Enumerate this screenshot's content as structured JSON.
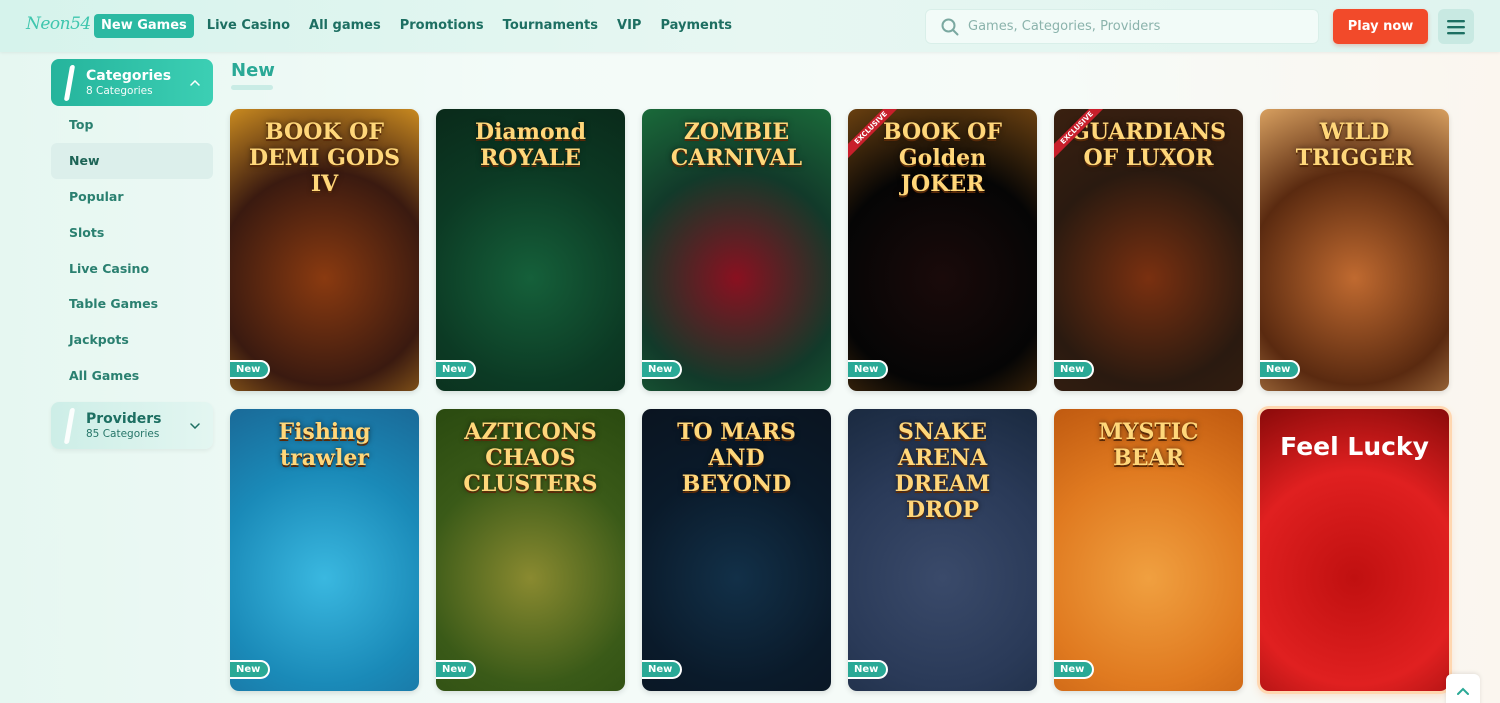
{
  "header": {
    "logo": "Neon54",
    "nav": [
      "New Games",
      "Live Casino",
      "All games",
      "Promotions",
      "Tournaments",
      "VIP",
      "Payments"
    ],
    "search_placeholder": "Games, Categories, Providers",
    "play_label": "Play now"
  },
  "sidebar": {
    "categories_title": "Categories",
    "categories_sub": "8 Categories",
    "items": [
      "Top",
      "New",
      "Popular",
      "Slots",
      "Live Casino",
      "Table Games",
      "Jackpots",
      "All Games"
    ],
    "providers_title": "Providers",
    "providers_sub": "85 Categories"
  },
  "main": {
    "section_title": "New",
    "badge": "New",
    "exclusive": "EXCLUSIVE",
    "games": [
      {
        "title": "BOOK OF DEMI GODS IV",
        "colors": [
          "#3a1a10",
          "#8a3a10",
          "#c98a20"
        ]
      },
      {
        "title": "Diamond ROYALE",
        "colors": [
          "#0c3a24",
          "#15603a",
          "#0a2a1a"
        ]
      },
      {
        "title": "ZOMBIE CARNIVAL",
        "colors": [
          "#123a2a",
          "#8a1020",
          "#1a6a3a"
        ]
      },
      {
        "title": "BOOK OF Golden JOKER",
        "colors": [
          "#050505",
          "#1a0a0a",
          "#6a4010"
        ]
      },
      {
        "title": "GUARDIANS OF LUXOR",
        "colors": [
          "#2a1a10",
          "#7a3010",
          "#3a2010"
        ]
      },
      {
        "title": "WILD TRIGGER",
        "colors": [
          "#5a2a10",
          "#c06a30",
          "#d8a060"
        ]
      },
      {
        "title": "Fishing trawler",
        "colors": [
          "#1a8ab8",
          "#3ab8e0",
          "#1a6a98"
        ]
      },
      {
        "title": "AZTICONS CHAOS CLUSTERS",
        "colors": [
          "#3a5a18",
          "#8a8a30",
          "#2a4a10"
        ]
      },
      {
        "title": "TO MARS AND BEYOND",
        "colors": [
          "#0a1a2a",
          "#123048",
          "#0a1420"
        ]
      },
      {
        "title": "SNAKE ARENA DREAM DROP",
        "colors": [
          "#2a3a58",
          "#3a4a6a",
          "#1a2a40"
        ]
      },
      {
        "title": "MYSTIC BEAR",
        "colors": [
          "#e07a20",
          "#f0a040",
          "#c05a10"
        ]
      },
      {
        "title": "Feel Lucky",
        "colors": [
          "#e02020",
          "#c01010",
          "#8a0a0a"
        ]
      }
    ]
  }
}
